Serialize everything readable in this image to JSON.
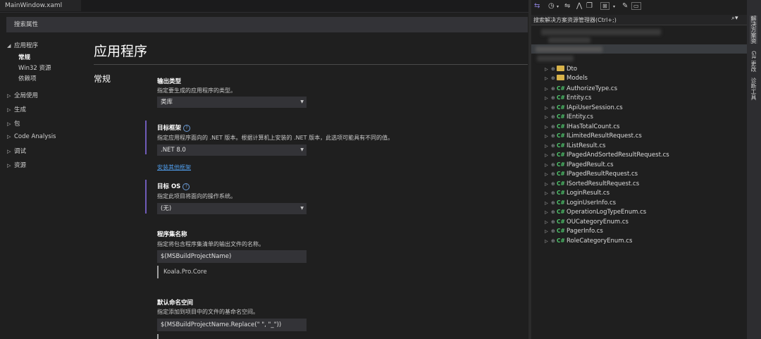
{
  "document_tab": {
    "title": "MainWindow.xaml"
  },
  "search": {
    "placeholder": "搜索属性"
  },
  "nav": {
    "groups": [
      {
        "label": "应用程序",
        "expanded": true
      },
      {
        "label": "全局使用"
      },
      {
        "label": "生成"
      },
      {
        "label": "包"
      },
      {
        "label": "Code Analysis"
      },
      {
        "label": "调试"
      },
      {
        "label": "资源"
      }
    ],
    "subitems": [
      "常规",
      "Win32 资源",
      "依赖项"
    ]
  },
  "main": {
    "title": "应用程序",
    "section": "常规",
    "output_type": {
      "label": "输出类型",
      "desc": "指定要生成的应用程序的类型。",
      "value": "类库"
    },
    "target_framework": {
      "label": "目标框架",
      "desc": "指定应用程序面向的 .NET 版本。根据计算机上安装的 .NET 版本，此选项可能具有不同的值。",
      "value": ".NET 8.0",
      "link": "安装其他框架"
    },
    "target_os": {
      "label": "目标 OS",
      "desc": "指定此项目将面向的操作系统。",
      "value": "(无)"
    },
    "assembly_name": {
      "label": "程序集名称",
      "desc": "指定将包含程序集清单的输出文件的名称。",
      "value": "$(MSBuildProjectName)",
      "preview": "Koala.Pro.Core"
    },
    "default_namespace": {
      "label": "默认命名空间",
      "desc": "指定添加到项目中的文件的基命名空间。",
      "value": "$(MSBuildProjectName.Replace(\" \", \"_\"))"
    }
  },
  "solution_explorer": {
    "search_placeholder": "搜索解决方案资源管理器(Ctrl+;)",
    "items": [
      {
        "name": "Dto",
        "kind": "folder"
      },
      {
        "name": "Models",
        "kind": "folder"
      },
      {
        "name": "AuthorizeType.cs",
        "kind": "cs"
      },
      {
        "name": "Entity.cs",
        "kind": "cs"
      },
      {
        "name": "IApiUserSession.cs",
        "kind": "cs"
      },
      {
        "name": "IEntity.cs",
        "kind": "cs"
      },
      {
        "name": "IHasTotalCount.cs",
        "kind": "cs"
      },
      {
        "name": "ILimitedResultRequest.cs",
        "kind": "cs"
      },
      {
        "name": "IListResult.cs",
        "kind": "cs"
      },
      {
        "name": "IPagedAndSortedResultRequest.cs",
        "kind": "cs"
      },
      {
        "name": "IPagedResult.cs",
        "kind": "cs"
      },
      {
        "name": "IPagedResultRequest.cs",
        "kind": "cs"
      },
      {
        "name": "ISortedResultRequest.cs",
        "kind": "cs"
      },
      {
        "name": "LoginResult.cs",
        "kind": "cs"
      },
      {
        "name": "LoginUserInfo.cs",
        "kind": "cs"
      },
      {
        "name": "OperationLogTypeEnum.cs",
        "kind": "cs"
      },
      {
        "name": "OUCategoryEnum.cs",
        "kind": "cs"
      },
      {
        "name": "PagerInfo.cs",
        "kind": "cs"
      },
      {
        "name": "RoleCategoryEnum.cs",
        "kind": "cs"
      }
    ]
  },
  "side_tabs": [
    "解决方案资源管理器",
    "Git 更改",
    "诊断工具"
  ],
  "colors": {
    "accent": "#6f5bb8",
    "link": "#4f9be8",
    "cs_icon": "#4ec36b",
    "folder": "#d8b34a"
  }
}
